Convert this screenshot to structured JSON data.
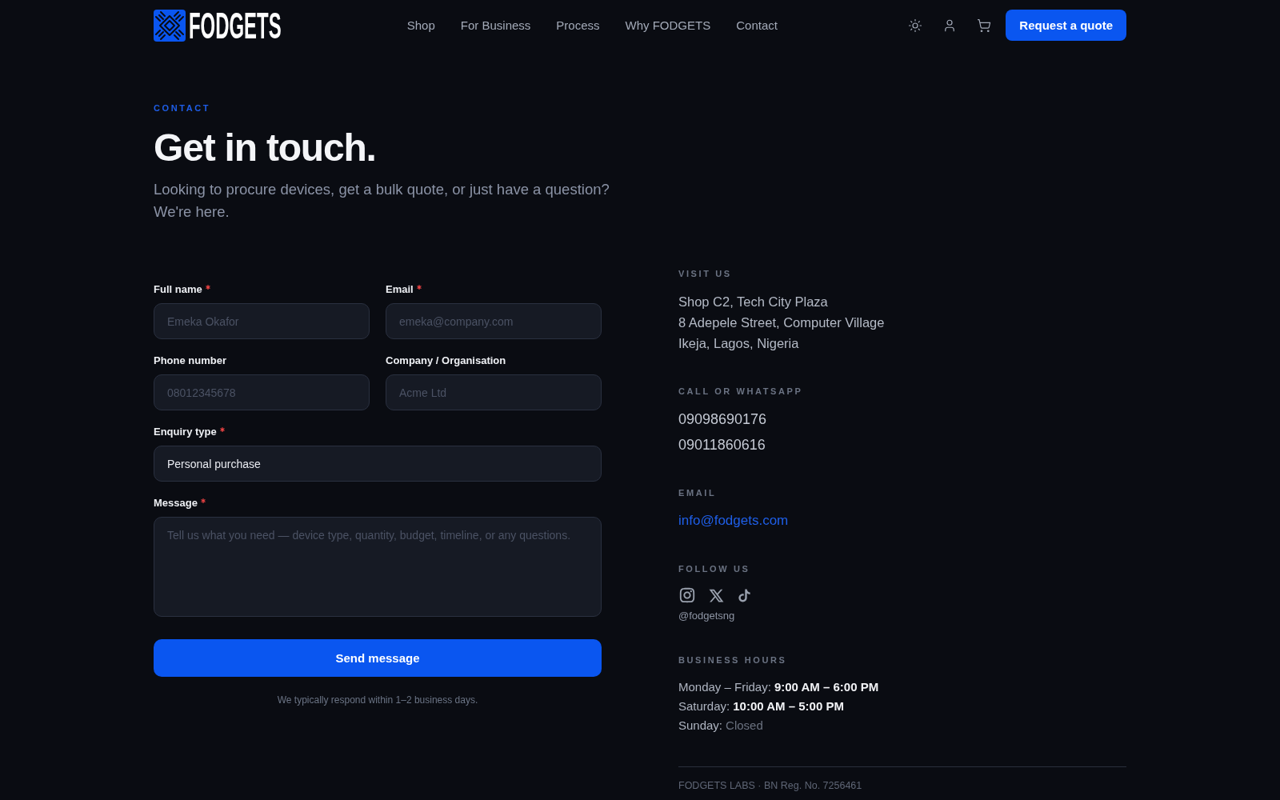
{
  "header": {
    "logo": "FODGETS",
    "nav": [
      {
        "label": "Shop"
      },
      {
        "label": "For Business"
      },
      {
        "label": "Process"
      },
      {
        "label": "Why FODGETS"
      },
      {
        "label": "Contact"
      }
    ],
    "cta": "Request a quote"
  },
  "hero": {
    "eyebrow": "CONTACT",
    "title": "Get in touch.",
    "subtitle": "Looking to procure devices, get a bulk quote, or just have a question? We're here."
  },
  "form": {
    "rows": [
      [
        {
          "kind": "input",
          "label": "Full name",
          "required": true,
          "placeholder": "Emeka Okafor"
        },
        {
          "kind": "input",
          "label": "Email",
          "required": true,
          "placeholder": "emeka@company.com"
        }
      ],
      [
        {
          "kind": "input",
          "label": "Phone number",
          "required": false,
          "placeholder": "08012345678"
        },
        {
          "kind": "input",
          "label": "Company / Organisation",
          "required": false,
          "placeholder": "Acme Ltd"
        }
      ],
      [
        {
          "kind": "select",
          "label": "Enquiry type",
          "required": true,
          "value": "Personal purchase"
        }
      ],
      [
        {
          "kind": "textarea",
          "label": "Message",
          "required": true,
          "placeholder": "Tell us what you need — device type, quantity, budget, timeline, or any questions."
        }
      ]
    ],
    "submit": "Send message",
    "note": "We typically respond within 1–2 business days."
  },
  "contact": {
    "address": {
      "heading": "VISIT US",
      "lines": [
        "Shop C2, Tech City Plaza",
        "8 Adepele Street, Computer Village",
        "Ikeja, Lagos, Nigeria"
      ]
    },
    "phones": {
      "heading": "CALL OR WHATSAPP",
      "numbers": [
        "09098690176",
        "09011860616"
      ]
    },
    "email": {
      "heading": "EMAIL",
      "address": "info@fodgets.com"
    },
    "social": {
      "heading": "FOLLOW US",
      "handle": "@fodgetsng"
    },
    "hours": {
      "heading": "BUSINESS HOURS",
      "rows": [
        {
          "day": "Monday – Friday:",
          "time": "9:00 AM – 6:00 PM",
          "closed": false
        },
        {
          "day": "Saturday:",
          "time": "10:00 AM – 5:00 PM",
          "closed": false
        },
        {
          "day": "Sunday:",
          "time": "Closed",
          "closed": true
        }
      ]
    },
    "footer": "FODGETS LABS · BN Reg. No. 7256461"
  }
}
